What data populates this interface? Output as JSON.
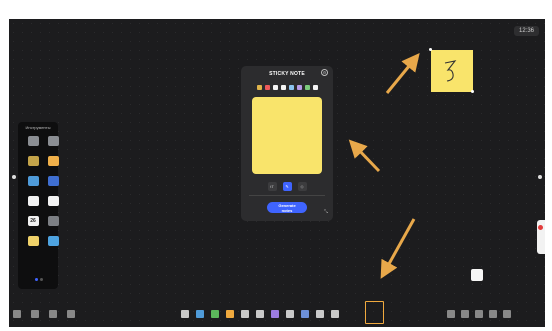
{
  "clock": "12:36",
  "tools_panel": {
    "title": "Инструменты",
    "items": [
      {
        "label": "",
        "icon": "tool-tile-icon",
        "color": "#8b8e93"
      },
      {
        "label": "",
        "icon": "tool-tile-icon",
        "color": "#8b8e93"
      },
      {
        "label": "",
        "icon": "tool-tile-icon",
        "color": "#c4a44a"
      },
      {
        "label": "",
        "icon": "tool-tile-icon",
        "color": "#f0b04a"
      },
      {
        "label": "",
        "icon": "tool-tile-icon",
        "color": "#4f9bd9"
      },
      {
        "label": "",
        "icon": "tool-tile-icon",
        "color": "#3f6fd1"
      },
      {
        "label": "",
        "icon": "tool-tile-icon",
        "color": "#f2f2f2"
      },
      {
        "label": "",
        "icon": "tool-tile-icon",
        "color": "#f2f2f2"
      },
      {
        "label": "",
        "icon": "calendar-icon",
        "color": "#f2f2f2"
      },
      {
        "label": "",
        "icon": "timer-icon",
        "color": "#7c7f84"
      },
      {
        "label": "",
        "icon": "tool-tile-icon",
        "color": "#f0d26a"
      },
      {
        "label": "",
        "icon": "tool-tile-icon",
        "color": "#4ea3e0"
      }
    ],
    "calendar_day": "26"
  },
  "sticky_panel": {
    "title": "STICKY NOTE",
    "swatches": [
      "#e0b54b",
      "#ef5a5a",
      "#f4f4f4",
      "#f4f4f4",
      "#8bc4f0",
      "#b79ce8",
      "#7ccb7c",
      "#f4f4f4"
    ],
    "tool_text": "tT",
    "generate_label": "Generate notes"
  },
  "bottom_left": [
    {
      "label": "",
      "color": "#888"
    },
    {
      "label": "",
      "color": "#888"
    },
    {
      "label": "",
      "color": "#888"
    },
    {
      "label": "",
      "color": "#888"
    }
  ],
  "bottom_center": [
    {
      "label": "",
      "color": "#c9c9c9"
    },
    {
      "label": "",
      "color": "#4f9bd9"
    },
    {
      "label": "",
      "color": "#5cb85c"
    },
    {
      "label": "",
      "color": "#f0a93e"
    },
    {
      "label": "",
      "color": "#c9c9c9"
    },
    {
      "label": "",
      "color": "#c9c9c9"
    },
    {
      "label": "",
      "color": "#9b7be0"
    },
    {
      "label": "",
      "color": "#c9c9c9"
    },
    {
      "label": "",
      "color": "#6c8fd8"
    },
    {
      "label": "",
      "color": "#c9c9c9"
    },
    {
      "label": "",
      "color": "#c9c9c9"
    }
  ],
  "bottom_right": [
    {
      "label": "",
      "color": "#888"
    },
    {
      "label": "",
      "color": "#888"
    },
    {
      "label": "",
      "color": "#888"
    },
    {
      "label": "",
      "color": "#888"
    },
    {
      "label": "",
      "color": "#888"
    }
  ],
  "accent": "#3f64ff",
  "note_color": "#f9e46b",
  "arrow_color": "#e8a84a",
  "highlight_color": "#f0a93e"
}
